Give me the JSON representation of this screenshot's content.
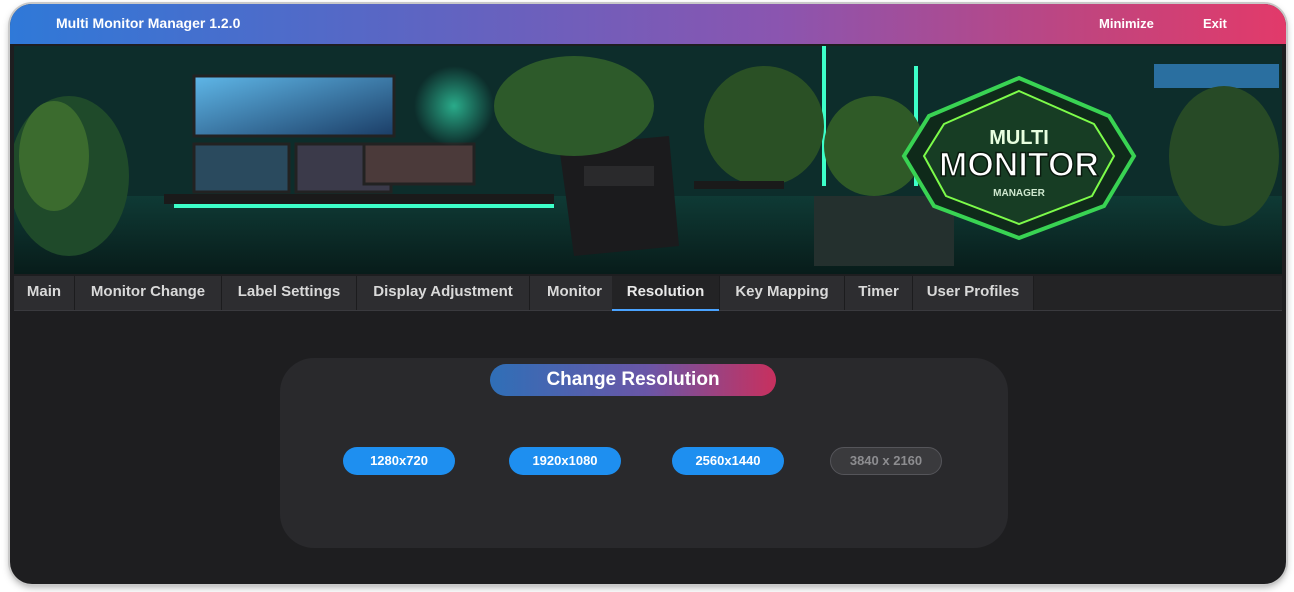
{
  "window": {
    "title": "Multi Monitor Manager 1.2.0",
    "minimize_label": "Minimize",
    "exit_label": "Exit"
  },
  "banner": {
    "logo_top": "MULTI",
    "logo_main": "MONITOR",
    "logo_bottom": "MANAGER"
  },
  "tabs": [
    {
      "label": "Main"
    },
    {
      "label": "Monitor Change"
    },
    {
      "label": "Label Settings"
    },
    {
      "label": "Display Adjustment"
    },
    {
      "label": "Monitor"
    },
    {
      "label": "Resolution",
      "active": true
    },
    {
      "label": "Key Mapping"
    },
    {
      "label": "Timer"
    },
    {
      "label": "User Profiles"
    }
  ],
  "resolution_panel": {
    "title": "Change Resolution",
    "buttons": [
      {
        "label": "1280x720",
        "enabled": true
      },
      {
        "label": "1920x1080",
        "enabled": true
      },
      {
        "label": "2560x1440",
        "enabled": true
      },
      {
        "label": "3840 x 2160",
        "enabled": false
      }
    ]
  },
  "colors": {
    "accent_blue": "#1e8ff0",
    "title_gradient_start": "#2f79d8",
    "title_gradient_end": "#e23a6a",
    "background": "#1e1e20",
    "panel": "#29292c"
  }
}
